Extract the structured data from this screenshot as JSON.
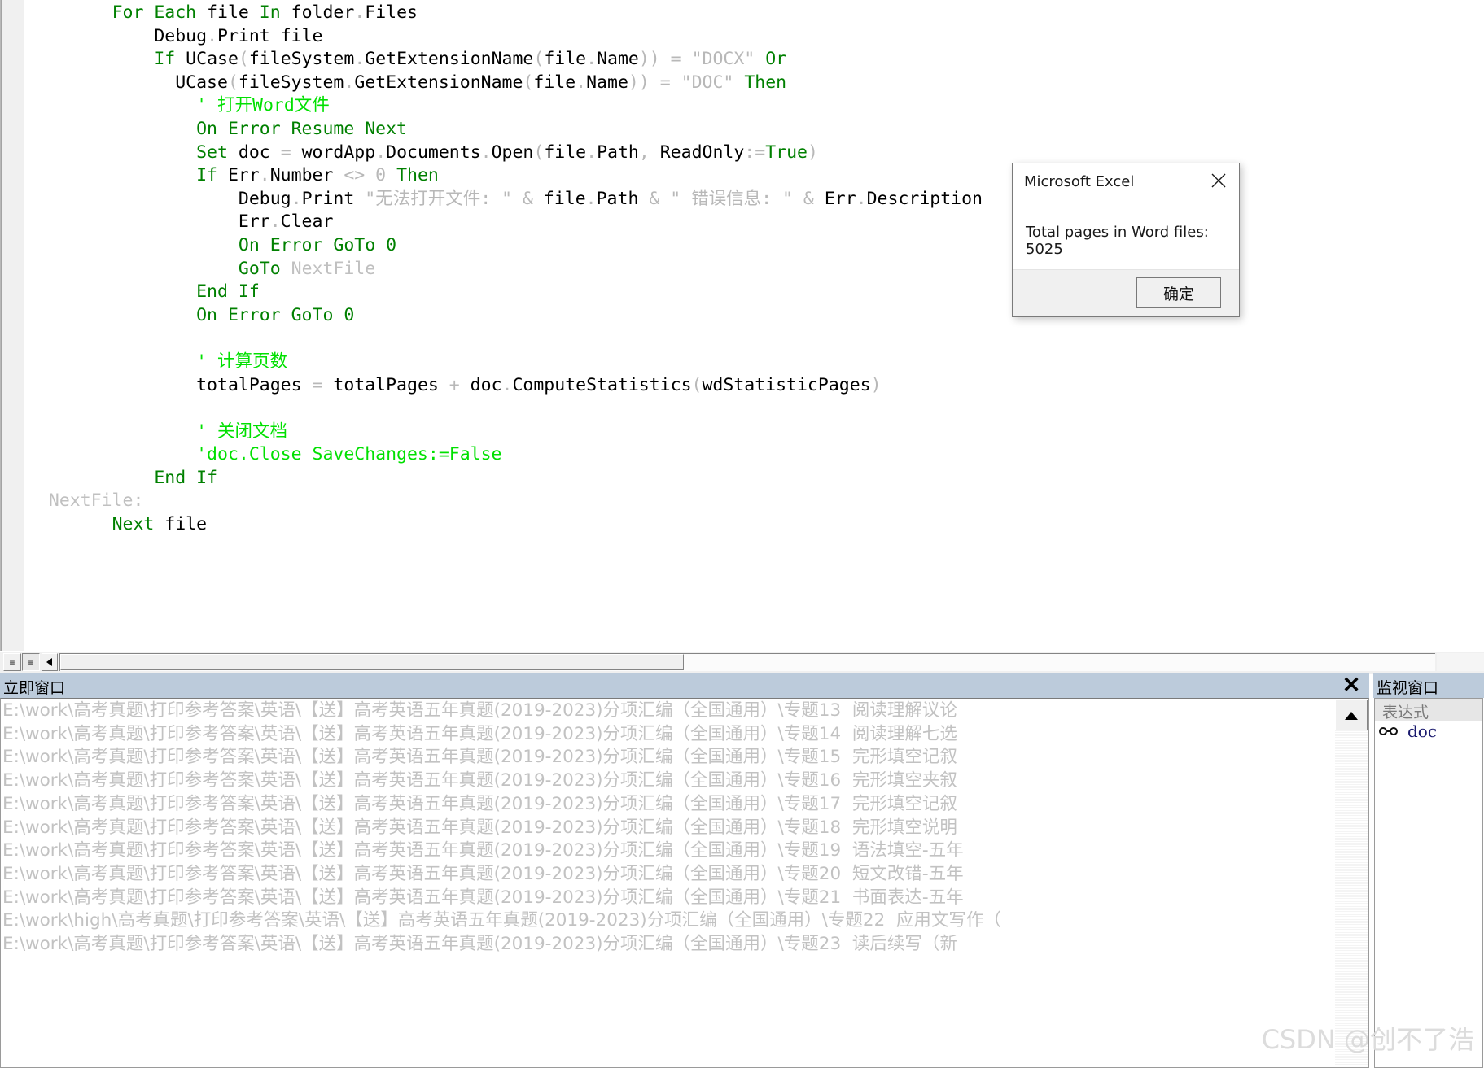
{
  "code_editor": {
    "lines": [
      [
        {
          "t": "        ",
          "c": "id"
        },
        {
          "t": "For Each",
          "c": "kw"
        },
        {
          "t": " file ",
          "c": "id"
        },
        {
          "t": "In",
          "c": "kw"
        },
        {
          "t": " folder",
          "c": "id"
        },
        {
          "t": ".",
          "c": "op"
        },
        {
          "t": "Files",
          "c": "id"
        }
      ],
      [
        {
          "t": "            Debug",
          "c": "id"
        },
        {
          "t": ".",
          "c": "op"
        },
        {
          "t": "Print",
          "c": "id"
        },
        {
          "t": " file",
          "c": "id"
        }
      ],
      [
        {
          "t": "            ",
          "c": "id"
        },
        {
          "t": "If",
          "c": "kw"
        },
        {
          "t": " UCase",
          "c": "id"
        },
        {
          "t": "(",
          "c": "op"
        },
        {
          "t": "fileSystem",
          "c": "id"
        },
        {
          "t": ".",
          "c": "op"
        },
        {
          "t": "GetExtensionName",
          "c": "id"
        },
        {
          "t": "(",
          "c": "op"
        },
        {
          "t": "file",
          "c": "id"
        },
        {
          "t": ".",
          "c": "op"
        },
        {
          "t": "Name",
          "c": "id"
        },
        {
          "t": "))",
          "c": "op"
        },
        {
          "t": " = ",
          "c": "op"
        },
        {
          "t": "\"DOCX\"",
          "c": "str"
        },
        {
          "t": " ",
          "c": "id"
        },
        {
          "t": "Or",
          "c": "kw"
        },
        {
          "t": " ",
          "c": "id"
        },
        {
          "t": "_",
          "c": "op"
        }
      ],
      [
        {
          "t": "              UCase",
          "c": "id"
        },
        {
          "t": "(",
          "c": "op"
        },
        {
          "t": "fileSystem",
          "c": "id"
        },
        {
          "t": ".",
          "c": "op"
        },
        {
          "t": "GetExtensionName",
          "c": "id"
        },
        {
          "t": "(",
          "c": "op"
        },
        {
          "t": "file",
          "c": "id"
        },
        {
          "t": ".",
          "c": "op"
        },
        {
          "t": "Name",
          "c": "id"
        },
        {
          "t": "))",
          "c": "op"
        },
        {
          "t": " = ",
          "c": "op"
        },
        {
          "t": "\"DOC\"",
          "c": "str"
        },
        {
          "t": " ",
          "c": "id"
        },
        {
          "t": "Then",
          "c": "kw"
        }
      ],
      [
        {
          "t": "                ",
          "c": "id"
        },
        {
          "t": "' 打开Word文件",
          "c": "cmt"
        }
      ],
      [
        {
          "t": "                ",
          "c": "id"
        },
        {
          "t": "On Error Resume Next",
          "c": "kw"
        }
      ],
      [
        {
          "t": "                ",
          "c": "id"
        },
        {
          "t": "Set",
          "c": "kw"
        },
        {
          "t": " doc ",
          "c": "id"
        },
        {
          "t": "= ",
          "c": "op"
        },
        {
          "t": "wordApp",
          "c": "id"
        },
        {
          "t": ".",
          "c": "op"
        },
        {
          "t": "Documents",
          "c": "id"
        },
        {
          "t": ".",
          "c": "op"
        },
        {
          "t": "Open",
          "c": "id"
        },
        {
          "t": "(",
          "c": "op"
        },
        {
          "t": "file",
          "c": "id"
        },
        {
          "t": ".",
          "c": "op"
        },
        {
          "t": "Path",
          "c": "id"
        },
        {
          "t": ", ",
          "c": "op"
        },
        {
          "t": "ReadOnly",
          "c": "id"
        },
        {
          "t": ":=",
          "c": "op"
        },
        {
          "t": "True",
          "c": "kw"
        },
        {
          "t": ")",
          "c": "op"
        }
      ],
      [
        {
          "t": "                ",
          "c": "id"
        },
        {
          "t": "If",
          "c": "kw"
        },
        {
          "t": " Err",
          "c": "id"
        },
        {
          "t": ".",
          "c": "op"
        },
        {
          "t": "Number",
          "c": "id"
        },
        {
          "t": " <> 0 ",
          "c": "op"
        },
        {
          "t": "Then",
          "c": "kw"
        }
      ],
      [
        {
          "t": "                    Debug",
          "c": "id"
        },
        {
          "t": ".",
          "c": "op"
        },
        {
          "t": "Print",
          "c": "id"
        },
        {
          "t": " ",
          "c": "id"
        },
        {
          "t": "\"无法打开文件: \"",
          "c": "str"
        },
        {
          "t": " & ",
          "c": "op"
        },
        {
          "t": "file",
          "c": "id"
        },
        {
          "t": ".",
          "c": "op"
        },
        {
          "t": "Path",
          "c": "id"
        },
        {
          "t": " & ",
          "c": "op"
        },
        {
          "t": "\" 错误信息: \"",
          "c": "str"
        },
        {
          "t": " & ",
          "c": "op"
        },
        {
          "t": "Err",
          "c": "id"
        },
        {
          "t": ".",
          "c": "op"
        },
        {
          "t": "Description",
          "c": "id"
        }
      ],
      [
        {
          "t": "                    Err",
          "c": "id"
        },
        {
          "t": ".",
          "c": "op"
        },
        {
          "t": "Clear",
          "c": "id"
        }
      ],
      [
        {
          "t": "                    ",
          "c": "id"
        },
        {
          "t": "On Error GoTo",
          "c": "kw"
        },
        {
          "t": " ",
          "c": "id"
        },
        {
          "t": "0",
          "c": "kw"
        }
      ],
      [
        {
          "t": "                    ",
          "c": "id"
        },
        {
          "t": "GoTo",
          "c": "kw"
        },
        {
          "t": " ",
          "c": "id"
        },
        {
          "t": "NextFile",
          "c": "lbl"
        }
      ],
      [
        {
          "t": "                ",
          "c": "id"
        },
        {
          "t": "End If",
          "c": "kw"
        }
      ],
      [
        {
          "t": "                ",
          "c": "id"
        },
        {
          "t": "On Error GoTo",
          "c": "kw"
        },
        {
          "t": " ",
          "c": "id"
        },
        {
          "t": "0",
          "c": "kw"
        }
      ],
      [
        {
          "t": "",
          "c": "id"
        }
      ],
      [
        {
          "t": "                ",
          "c": "id"
        },
        {
          "t": "' 计算页数",
          "c": "cmt"
        }
      ],
      [
        {
          "t": "                totalPages ",
          "c": "id"
        },
        {
          "t": "= ",
          "c": "op"
        },
        {
          "t": "totalPages ",
          "c": "id"
        },
        {
          "t": "+ ",
          "c": "op"
        },
        {
          "t": "doc",
          "c": "id"
        },
        {
          "t": ".",
          "c": "op"
        },
        {
          "t": "ComputeStatistics",
          "c": "id"
        },
        {
          "t": "(",
          "c": "op"
        },
        {
          "t": "wdStatisticPages",
          "c": "id"
        },
        {
          "t": ")",
          "c": "op"
        }
      ],
      [
        {
          "t": "",
          "c": "id"
        }
      ],
      [
        {
          "t": "                ",
          "c": "id"
        },
        {
          "t": "' 关闭文档",
          "c": "cmt"
        }
      ],
      [
        {
          "t": "                ",
          "c": "id"
        },
        {
          "t": "'doc.Close SaveChanges:=False",
          "c": "cmt"
        }
      ],
      [
        {
          "t": "            ",
          "c": "id"
        },
        {
          "t": "End If",
          "c": "kw"
        }
      ],
      [
        {
          "t": "  ",
          "c": "id"
        },
        {
          "t": "NextFile:",
          "c": "lbl"
        }
      ],
      [
        {
          "t": "        ",
          "c": "id"
        },
        {
          "t": "Next",
          "c": "kw"
        },
        {
          "t": " file",
          "c": "id"
        }
      ]
    ]
  },
  "dialog": {
    "title": "Microsoft Excel",
    "message": "Total pages in Word files: 5025",
    "ok_label": "确定",
    "close_icon": "close-icon"
  },
  "immediate_window": {
    "title": "立即窗口",
    "close_label": "✕",
    "lines": [
      "E:\\work\\高考真题\\打印参考答案\\英语\\【送】高考英语五年真题(2019-2023)分项汇编（全国通用）\\专题13  阅读理解议论",
      "E:\\work\\高考真题\\打印参考答案\\英语\\【送】高考英语五年真题(2019-2023)分项汇编（全国通用）\\专题14  阅读理解七选",
      "E:\\work\\高考真题\\打印参考答案\\英语\\【送】高考英语五年真题(2019-2023)分项汇编（全国通用）\\专题15  完形填空记叙",
      "E:\\work\\高考真题\\打印参考答案\\英语\\【送】高考英语五年真题(2019-2023)分项汇编（全国通用）\\专题16  完形填空夹叙",
      "E:\\work\\高考真题\\打印参考答案\\英语\\【送】高考英语五年真题(2019-2023)分项汇编（全国通用）\\专题17  完形填空记叙",
      "E:\\work\\高考真题\\打印参考答案\\英语\\【送】高考英语五年真题(2019-2023)分项汇编（全国通用）\\专题18  完形填空说明",
      "E:\\work\\高考真题\\打印参考答案\\英语\\【送】高考英语五年真题(2019-2023)分项汇编（全国通用）\\专题19  语法填空-五年",
      "E:\\work\\高考真题\\打印参考答案\\英语\\【送】高考英语五年真题(2019-2023)分项汇编（全国通用）\\专题20  短文改错-五年",
      "E:\\work\\高考真题\\打印参考答案\\英语\\【送】高考英语五年真题(2019-2023)分项汇编（全国通用）\\专题21  书面表达-五年",
      "E:\\work\\high\\高考真题\\打印参考答案\\英语\\【送】高考英语五年真题(2019-2023)分项汇编（全国通用）\\专题22  应用文写作（",
      "E:\\work\\高考真题\\打印参考答案\\英语\\【送】高考英语五年真题(2019-2023)分项汇编（全国通用）\\专题23  读后续写（新"
    ]
  },
  "watch_window": {
    "title": "监视窗口",
    "column_expression": "表达式",
    "rows": [
      {
        "icon": "glasses-icon",
        "expression": "doc"
      }
    ]
  },
  "watermark": "CSDN @创不了浩"
}
